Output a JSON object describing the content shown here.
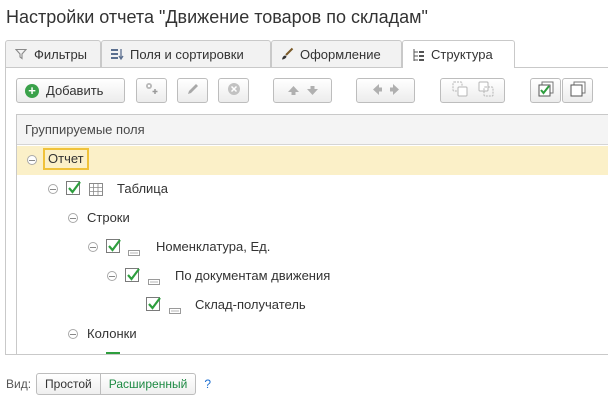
{
  "title": "Настройки отчета \"Движение товаров по складам\"",
  "tabs": [
    {
      "label": "Фильтры",
      "icon": "funnel-icon",
      "active": false
    },
    {
      "label": "Поля и сортировки",
      "icon": "fields-icon",
      "active": false
    },
    {
      "label": "Оформление",
      "icon": "brush-icon",
      "active": false
    },
    {
      "label": "Структура",
      "icon": "structure-icon",
      "active": true
    }
  ],
  "toolbar": {
    "add_label": "Добавить",
    "buttons": [
      "add-grouping-icon",
      "edit-pencil-icon",
      "delete-icon",
      "move-up-icon",
      "move-down-icon",
      "move-left-icon",
      "move-right-icon",
      "group-icon",
      "ungroup-icon",
      "check-all-icon",
      "copy-icon"
    ]
  },
  "grid": {
    "header": "Группируемые поля",
    "rows": [
      {
        "label": "Отчет",
        "checked": null,
        "icon": null,
        "selected": true
      },
      {
        "label": "Таблица",
        "checked": true,
        "icon": "table-icon",
        "selected": false
      },
      {
        "label": "Строки",
        "checked": null,
        "icon": null,
        "selected": false
      },
      {
        "label": "Номенклатура, Ед.",
        "checked": true,
        "icon": "field-icon",
        "selected": false
      },
      {
        "label": "По документам движения",
        "checked": true,
        "icon": "field-icon",
        "selected": false
      },
      {
        "label": "Склад-получатель",
        "checked": true,
        "icon": "field-icon",
        "selected": false
      },
      {
        "label": "Колонки",
        "checked": null,
        "icon": null,
        "selected": false
      }
    ]
  },
  "footer": {
    "view_label": "Вид:",
    "options": [
      "Простой",
      "Расширенный"
    ],
    "selected": "Расширенный",
    "help": "?"
  },
  "colors": {
    "selected_row": "#fbf0c8",
    "focus_border": "#f0c23a",
    "check": "#2e9e3e",
    "add_green": "#3aa14a",
    "link_green": "#1d8a43",
    "link_blue": "#1d6fd1"
  }
}
